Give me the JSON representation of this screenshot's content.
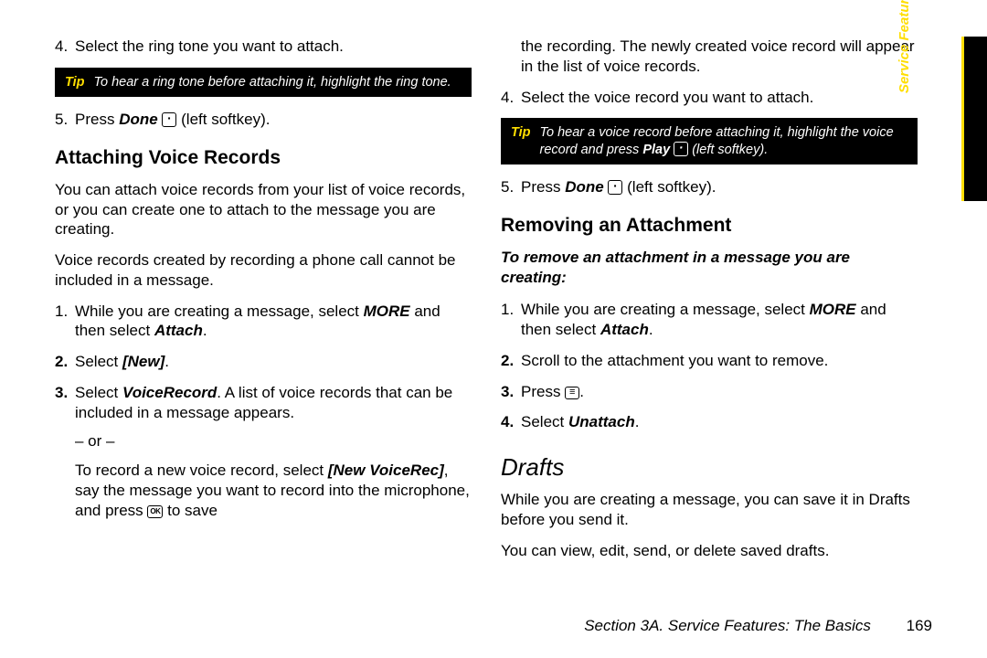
{
  "sideTab": "Service Features",
  "footer": {
    "section": "Section 3A. Service Features: The Basics",
    "page": "169"
  },
  "left": {
    "step4": {
      "num": "4.",
      "text": "Select the ring tone you want to attach."
    },
    "tip1": {
      "label": "Tip",
      "body": "To hear a ring tone before attaching it, highlight the ring tone."
    },
    "step5": {
      "num": "5.",
      "pre": "Press ",
      "done": "Done",
      "post": " (left softkey)."
    },
    "h_attach": "Attaching Voice Records",
    "p_attach1": "You can attach voice records from your list of voice records, or you can create one to attach to the message you are creating.",
    "p_attach2": "Voice records created by recording a phone call cannot be included in a message.",
    "a_li1": {
      "num": "1.",
      "pre": "While you are creating a message, select ",
      "more": "MORE",
      "mid": " and then select ",
      "attach": "Attach",
      "post": "."
    },
    "a_li2": {
      "num": "2.",
      "pre": "Select ",
      "new": "[New]",
      "post": "."
    },
    "a_li3": {
      "num": "3.",
      "pre": "Select ",
      "vr": "VoiceRecord",
      "post": ". A list of voice records that can be included in a message appears.",
      "or": "– or –",
      "sub_pre": "To record a new voice record, select ",
      "nvr": "[New VoiceRec]",
      "sub_mid": ", say the message you want to record into the microphone, and press ",
      "sub_post": " to save"
    }
  },
  "right": {
    "cont": "the recording. The newly created voice record will appear in the list of voice records.",
    "r_li4": {
      "num": "4.",
      "text": "Select the voice record you want to attach."
    },
    "tip2": {
      "label": "Tip",
      "pre": "To hear a voice record before attaching it, highlight the voice record and press ",
      "play": "Play",
      "post": " (left softkey)."
    },
    "r_li5": {
      "num": "5.",
      "pre": "Press ",
      "done": "Done",
      "post": " (left softkey)."
    },
    "h_remove": "Removing an Attachment",
    "intro_remove": "To remove an attachment in a message you are creating:",
    "rm_li1": {
      "num": "1.",
      "pre": "While you are creating a message, select ",
      "more": "MORE",
      "mid": " and then select ",
      "attach": "Attach",
      "post": "."
    },
    "rm_li2": {
      "num": "2.",
      "text": "Scroll to the attachment you want to remove."
    },
    "rm_li3": {
      "num": "3.",
      "pre": "Press ",
      "post": "."
    },
    "rm_li4": {
      "num": "4.",
      "pre": "Select ",
      "unattach": "Unattach",
      "post": "."
    },
    "h_drafts": "Drafts",
    "p_drafts1": "While you are creating a message, you can save it in Drafts before you send it.",
    "p_drafts2": "You can view, edit, send, or delete saved drafts."
  }
}
